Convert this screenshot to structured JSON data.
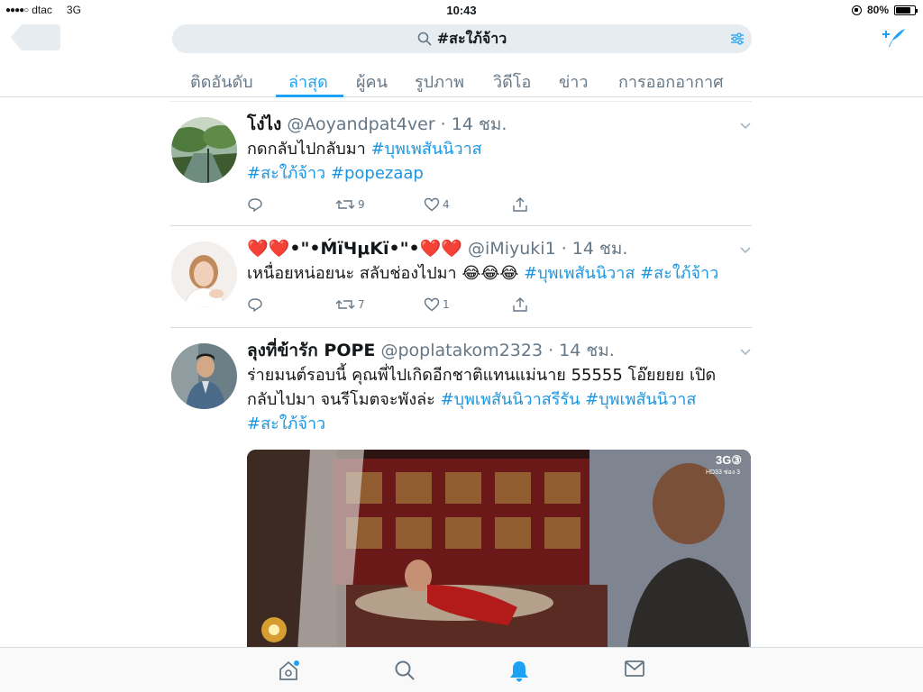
{
  "status_bar": {
    "carrier": "dtac",
    "signal_dots": "●●●●○",
    "network": "3G",
    "time": "10:43",
    "battery_percent": "80%",
    "battery_level": 0.8
  },
  "header": {
    "search_query": "#สะใภ้จ้าว"
  },
  "tabs": [
    {
      "label": "ติดอันดับ",
      "active": false
    },
    {
      "label": "ล่าสุด",
      "active": true
    },
    {
      "label": "ผู้คน",
      "active": false
    },
    {
      "label": "รูปภาพ",
      "active": false
    },
    {
      "label": "วิดีโอ",
      "active": false
    },
    {
      "label": "ข่าว",
      "active": false
    },
    {
      "label": "การออกอากาศ",
      "active": false
    }
  ],
  "tweets": [
    {
      "name": "โง่ไง",
      "handle": "@Aoyandpat4ver",
      "time": "14 ชม.",
      "text_plain": "กดกลับไปกลับมา ",
      "hashtags": [
        "#บุพเพสันนิวาส",
        "#สะใภ้จ้าว",
        "#popezaap"
      ],
      "retweets": "9",
      "likes": "4"
    },
    {
      "name": "❤️❤️•\"•ḾïЧμKï•\"•❤️❤️",
      "handle": "@iMiyuki1",
      "time": "14 ชม.",
      "text_plain": "เหนื่อยหน่อยนะ สลับช่องไปมา 😂😂😂 ",
      "hashtags": [
        "#บุพเพสันนิวาส",
        "#สะใภ้จ้าว"
      ],
      "retweets": "7",
      "likes": "1"
    },
    {
      "name": "ลุงที่ข้ารัก POPE",
      "handle": "@poplatakom2323",
      "time": "14 ชม.",
      "text_line1": "ร่ายมนต์รอบนี้ คุณพี่ไปเกิดอีกชาติแทนแม่นาย 55555 โอ๊ยยยย เปิด",
      "text_line2": "กลับไปมา จนรีโมตจะพังล่ะ ",
      "hashtags": [
        "#บุพเพสันนิวาสรีรัน",
        "#บุพเพสันนิวาส",
        "#สะใภ้จ้าว"
      ],
      "media_logo": "3G③",
      "media_sub": "HD33 ช่อง 3"
    }
  ],
  "colors": {
    "accent": "#1da1f2",
    "hashtag": "#1b95e0",
    "secondary_text": "#657786",
    "search_bg": "#e6ecf0"
  },
  "icons": {
    "bottom_bar": [
      "home-icon",
      "search-icon",
      "notifications-icon",
      "messages-icon"
    ]
  }
}
